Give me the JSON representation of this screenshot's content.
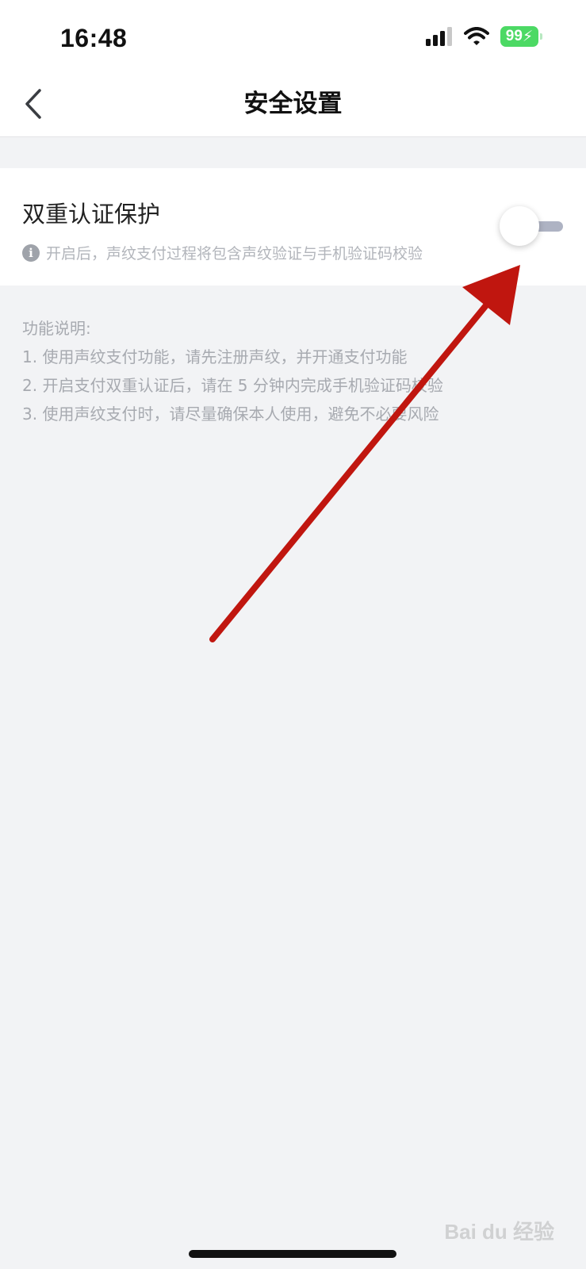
{
  "status_bar": {
    "time": "16:48",
    "battery": "99",
    "icons": [
      "signal-icon",
      "wifi-icon",
      "battery-charging-icon"
    ]
  },
  "nav": {
    "title": "安全设置",
    "back_icon": "chevron-left-icon"
  },
  "setting": {
    "title": "双重认证保护",
    "description": "开启后，声纹支付过程将包含声纹验证与手机验证码校验",
    "info_icon": "info-icon",
    "toggle_on": false
  },
  "notes": {
    "title": "功能说明:",
    "items": [
      "1. 使用声纹支付功能，请先注册声纹，并开通支付功能",
      "2. 开启支付双重认证后，请在 5 分钟内完成手机验证码校验",
      "3. 使用声纹支付时，请尽量确保本人使用，避免不必要风险"
    ]
  },
  "watermark": "Bai du 经验",
  "colors": {
    "background": "#f2f3f5",
    "card": "#ffffff",
    "annotation_arrow": "#c0160f",
    "toggle_track": "#aeb3c3"
  }
}
